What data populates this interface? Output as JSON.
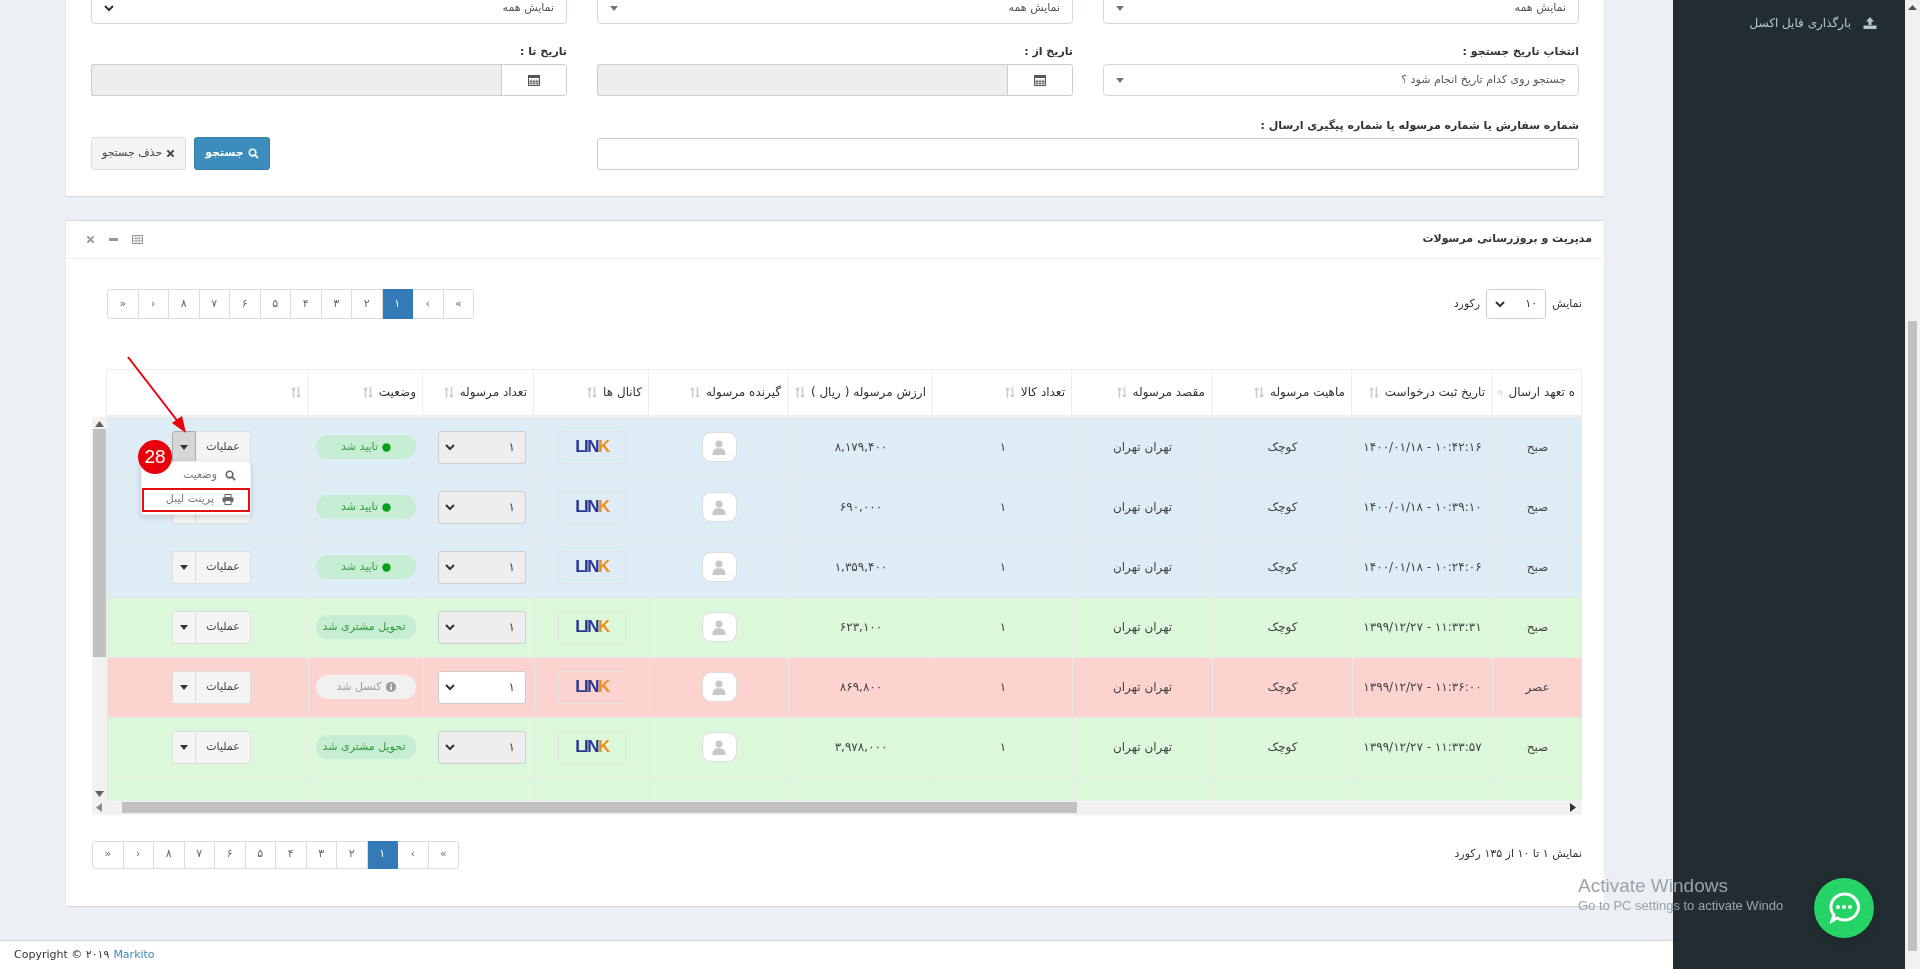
{
  "sidebar": {
    "items": [
      {
        "label": "بارگذاری فایل اکسل"
      }
    ]
  },
  "filters": {
    "selects": [
      {
        "value": "نمایش همه",
        "kind": "caret"
      },
      {
        "value": "نمایش همه",
        "kind": "caret"
      },
      {
        "value": "نمایش همه",
        "kind": "chevron"
      }
    ],
    "date_filter": {
      "label": "انتخاب تاریخ جستجو :",
      "placeholder": "جستجو روی کدام تاریخ انجام شود ؟"
    },
    "date_from": {
      "label": "تاریخ از :",
      "disabled": true
    },
    "date_to": {
      "label": "تاریخ تا :",
      "disabled": true
    },
    "order_search": {
      "label": "شماره سفارش یا شماره مرسوله یا شماره پیگیری ارسال :"
    },
    "buttons": [
      {
        "kind": "primary",
        "label": "جستجو"
      },
      {
        "kind": "secondary",
        "label": "حذف جستجو"
      }
    ]
  },
  "panel": {
    "title": "مدیریت و بروزرسانی مرسولات",
    "page_length": {
      "prefix": "نمایش",
      "value": "۱۰",
      "suffix": "رکورد"
    },
    "pagination_top": [
      {
        "label": "«",
        "selected": false
      },
      {
        "label": "‹",
        "selected": false
      },
      {
        "label": "۱",
        "selected": true
      },
      {
        "label": "۲",
        "selected": false
      },
      {
        "label": "۳",
        "selected": false
      },
      {
        "label": "۴",
        "selected": false
      },
      {
        "label": "۵",
        "selected": false
      },
      {
        "label": "۶",
        "selected": false
      },
      {
        "label": "۷",
        "selected": false
      },
      {
        "label": "۸",
        "selected": false
      },
      {
        "label": "›",
        "selected": false
      },
      {
        "label": "»",
        "selected": false
      }
    ],
    "columns": [
      "ه تعهد ارسال",
      "تاریخ ثبت درخواست",
      "ماهیت مرسوله",
      "مقصد مرسوله",
      "تعداد کالا",
      "ارزش مرسوله ( ریال )",
      "گیرنده مرسوله",
      "کانال ها",
      "تعداد مرسوله",
      "وضعیت"
    ],
    "rows": [
      {
        "color": "#deecf6",
        "kind": "done",
        "shift": "صبح",
        "date": "۱۴۰۰/۰۱/۱۸ - ۱۰:۴۲:۱۶",
        "nature": "کوچک",
        "destination": "تهران تهران",
        "items": "۱",
        "value": "۸,۱۷۹,۴۰۰",
        "channel": "LINK",
        "qty": "۱",
        "qty_disabled": true,
        "status": "تایید شد",
        "actions": "عملیات",
        "menu_open": true,
        "menu": [
          {
            "label": "وضعیت",
            "highlighted": false
          },
          {
            "label": "پرینت لیبل",
            "highlighted": true
          }
        ]
      },
      {
        "color": "#deecf6",
        "kind": "done",
        "shift": "صبح",
        "date": "۱۴۰۰/۰۱/۱۸ - ۱۰:۳۹:۱۰",
        "nature": "کوچک",
        "destination": "تهران تهران",
        "items": "۱",
        "value": "۶۹۰,۰۰۰",
        "channel": "LINK",
        "qty": "۱",
        "qty_disabled": true,
        "status": "تایید شد",
        "menu_open": false
      },
      {
        "color": "#deecf6",
        "kind": "done",
        "shift": "صبح",
        "date": "۱۴۰۰/۰۱/۱۸ - ۱۰:۲۴:۰۶",
        "nature": "کوچک",
        "destination": "تهران تهران",
        "items": "۱",
        "value": "۱,۳۵۹,۴۰۰",
        "channel": "LINK",
        "qty": "۱",
        "qty_disabled": true,
        "status": "تایید شد",
        "actions": "عملیات",
        "menu_open": false
      },
      {
        "color": "#dbf8da",
        "kind": "done",
        "shift": "صبح",
        "date": "۱۳۹۹/۱۲/۲۷ - ۱۱:۳۳:۳۱",
        "nature": "کوچک",
        "destination": "تهران تهران",
        "items": "۱",
        "value": "۶۲۳,۱۰۰",
        "channel": "LINK",
        "qty": "۱",
        "qty_disabled": true,
        "status": "تحویل مشتری شد",
        "actions": "عملیات",
        "menu_open": false
      },
      {
        "color": "#fdd3d0",
        "kind": "cancelled",
        "shift": "عصر",
        "date": "۱۳۹۹/۱۲/۲۷ - ۱۱:۳۶:۰۰",
        "nature": "کوچک",
        "destination": "تهران تهران",
        "items": "۱",
        "value": "۸۶۹,۸۰۰",
        "channel": "LINK",
        "qty": "۱",
        "qty_disabled": false,
        "status": "کنسل شد",
        "actions": "عملیات",
        "menu_open": false
      },
      {
        "color": "#dbf8da",
        "kind": "done",
        "shift": "صبح",
        "date": "۱۳۹۹/۱۲/۲۷ - ۱۱:۳۳:۵۷",
        "nature": "کوچک",
        "destination": "تهران تهران",
        "items": "۱",
        "value": "۳,۹۷۸,۰۰۰",
        "channel": "LINK",
        "qty": "۱",
        "qty_disabled": true,
        "status": "تحویل مشتری شد",
        "actions": "عملیات",
        "menu_open": false
      },
      {
        "color": "#dbf8da"
      }
    ],
    "info": "نمایش ۱ تا ۱۰ از ۱۳۵ رکورد",
    "pagination_bottom": [
      {
        "label": "«",
        "selected": false
      },
      {
        "label": "‹",
        "selected": false
      },
      {
        "label": "۱",
        "selected": true
      },
      {
        "label": "۲",
        "selected": false
      },
      {
        "label": "۳",
        "selected": false
      },
      {
        "label": "۴",
        "selected": false
      },
      {
        "label": "۵",
        "selected": false
      },
      {
        "label": "۶",
        "selected": false
      },
      {
        "label": "۷",
        "selected": false
      },
      {
        "label": "۸",
        "selected": false
      },
      {
        "label": "›",
        "selected": false
      },
      {
        "label": "»",
        "selected": false
      }
    ]
  },
  "annotation": {
    "number": "28"
  },
  "footer": {
    "text": "Copyright © ۲۰۱۹",
    "link": "Markito"
  },
  "os_notice": {
    "title": "Activate Windows",
    "text": "Go to PC settings to activate Windo"
  }
}
